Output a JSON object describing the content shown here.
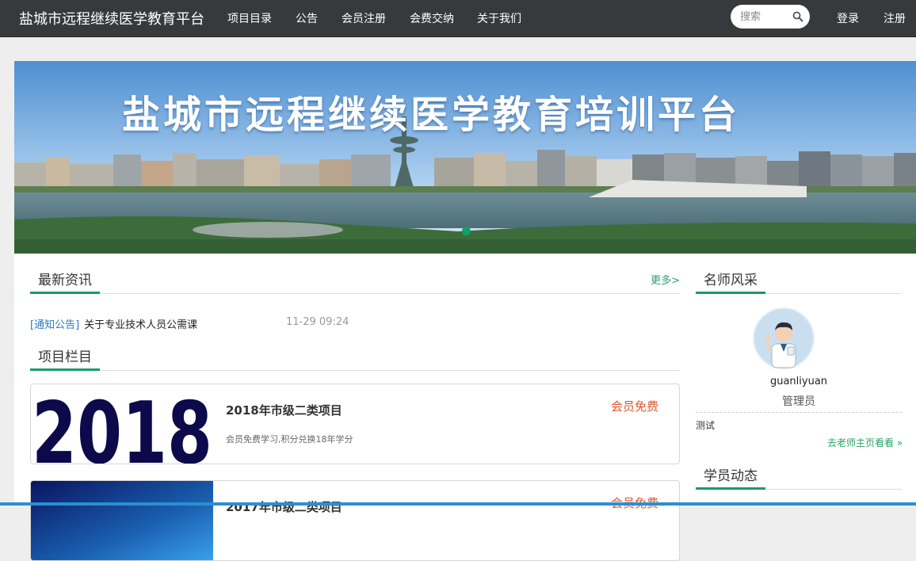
{
  "nav": {
    "brand": "盐城市远程继续医学教育平台",
    "links": [
      "项目目录",
      "公告",
      "会员注册",
      "会费交纳",
      "关于我们"
    ],
    "search_placeholder": "搜索",
    "login": "登录",
    "register": "注册",
    "search_icon": "search-icon"
  },
  "banner": {
    "title": "盐城市远程继续医学教育培训平台"
  },
  "news": {
    "section_title": "最新资讯",
    "more": "更多>",
    "items": [
      {
        "tag": "[通知公告]",
        "title": "关于专业技术人员公需课",
        "time": "11-29 09:24"
      }
    ]
  },
  "projects": {
    "section_title": "项目栏目",
    "items": [
      {
        "thumb_text": "2018",
        "title": "2018年市级二类项目",
        "desc": "会员免费学习,积分兑换18年学分",
        "badge": "会员免费"
      },
      {
        "thumb_text": "",
        "title": "2017年市级二类项目",
        "desc": "",
        "badge": "会员免费"
      }
    ]
  },
  "teachers": {
    "section_title": "名师风采",
    "name": "guanliyuan",
    "role": "管理员",
    "note": "测试",
    "link": "去老师主页看看 »"
  },
  "students": {
    "section_title": "学员动态"
  },
  "colors": {
    "nav_bg": "#363a3c",
    "accent_green": "#1c9a63",
    "badge_orange": "#e0572a",
    "tag_blue": "#2a7bbd"
  }
}
